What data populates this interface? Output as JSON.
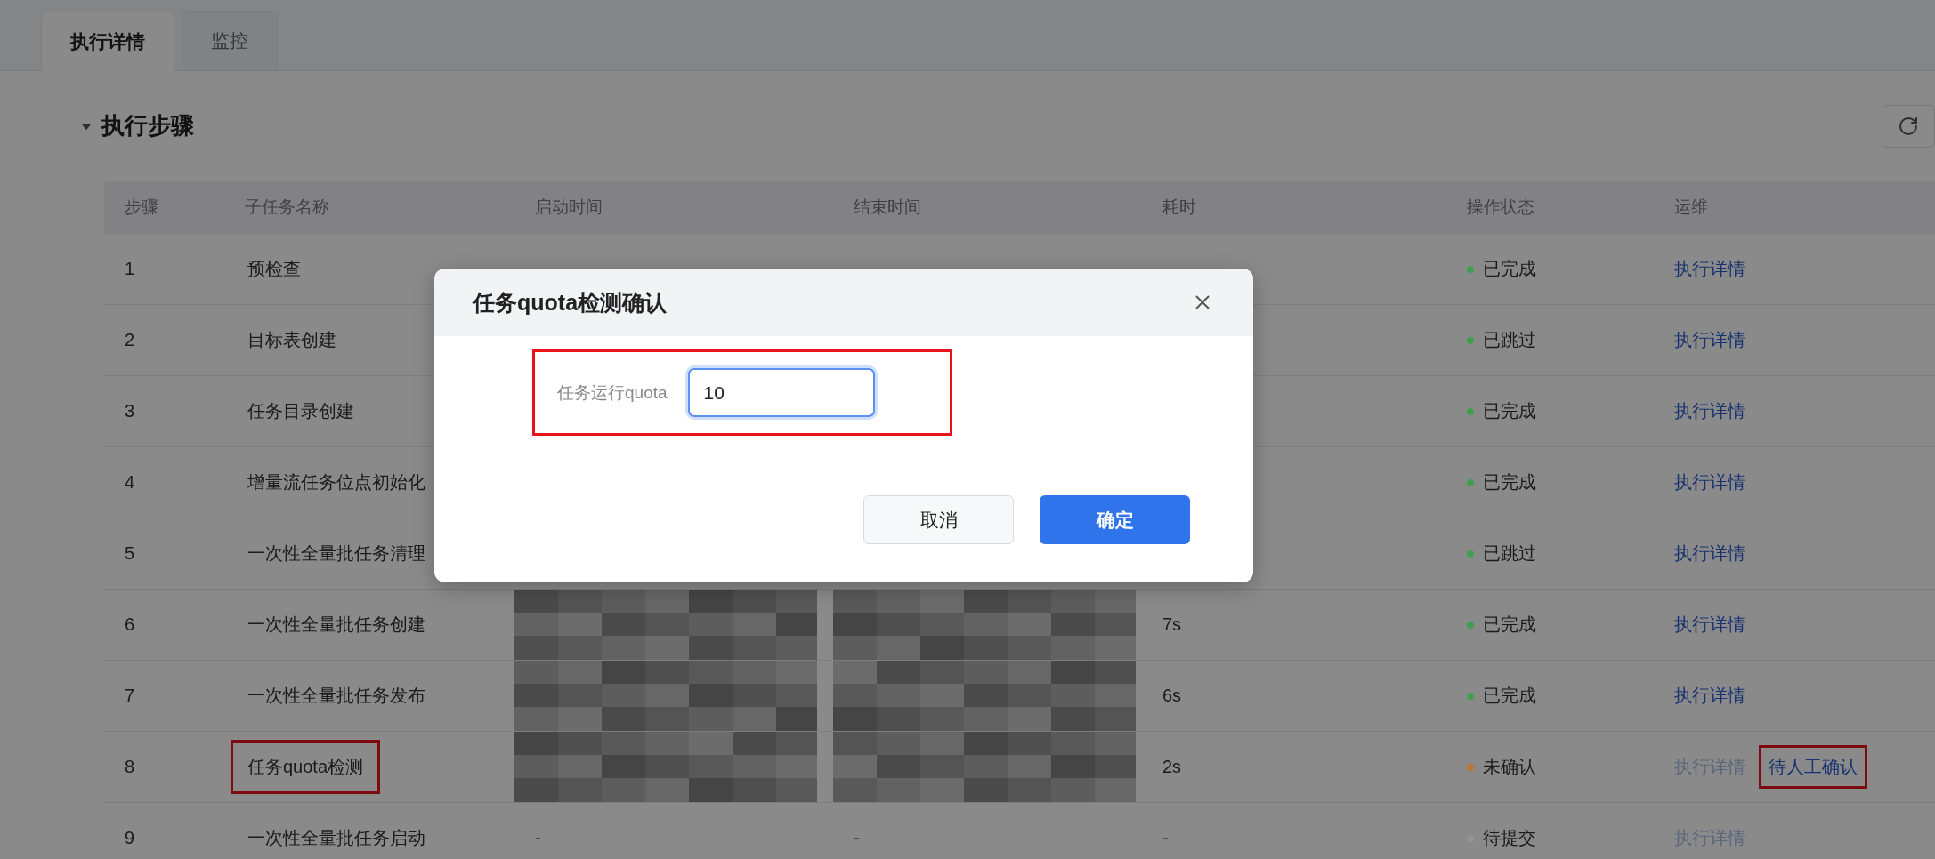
{
  "tabs": [
    {
      "label": "执行详情",
      "selected": true
    },
    {
      "label": "监控",
      "selected": false
    }
  ],
  "section": {
    "title": "执行步骤",
    "expanded": true
  },
  "table": {
    "columns": [
      "步骤",
      "子任务名称",
      "启动时间",
      "结束时间",
      "耗时",
      "操作状态",
      "运维"
    ],
    "rows": [
      {
        "step": "1",
        "name": "预检查",
        "name_highlighted": false,
        "redacted": false,
        "status": "已完成",
        "color": "#3f9f4f",
        "actions": [
          {
            "label": "执行详情",
            "disabled": false,
            "highlighted": false
          }
        ]
      },
      {
        "step": "2",
        "name": "目标表创建",
        "name_highlighted": false,
        "status": "已跳过",
        "color": "#3f9f4f",
        "actions": [
          {
            "label": "执行详情",
            "disabled": false,
            "highlighted": false
          }
        ]
      },
      {
        "step": "3",
        "name": "任务目录创建",
        "name_highlighted": false,
        "status": "已完成",
        "color": "#3f9f4f",
        "actions": [
          {
            "label": "执行详情",
            "disabled": false,
            "highlighted": false
          }
        ]
      },
      {
        "step": "4",
        "name": "增量流任务位点初始化",
        "name_highlighted": false,
        "status": "已完成",
        "color": "#3f9f4f",
        "actions": [
          {
            "label": "执行详情",
            "disabled": false,
            "highlighted": false
          }
        ]
      },
      {
        "step": "5",
        "name": "一次性全量批任务清理",
        "name_highlighted": false,
        "redacted": false,
        "status": "已跳过",
        "color": "#3f9f4f",
        "actions": [
          {
            "label": "执行详情",
            "disabled": false,
            "highlighted": false
          }
        ]
      },
      {
        "step": "6",
        "name": "一次性全量批任务创建",
        "name_highlighted": false,
        "redacted": true,
        "duration": "7s",
        "status": "已完成",
        "color": "#3f9f4f",
        "actions": [
          {
            "label": "执行详情",
            "disabled": false,
            "highlighted": false
          }
        ]
      },
      {
        "step": "7",
        "name": "一次性全量批任务发布",
        "name_highlighted": false,
        "redacted": true,
        "duration": "6s",
        "status": "已完成",
        "color": "#3f9f4f",
        "actions": [
          {
            "label": "执行详情",
            "disabled": false,
            "highlighted": false
          }
        ]
      },
      {
        "step": "8",
        "name": "任务quota检测",
        "name_highlighted": true,
        "redacted": true,
        "duration": "2s",
        "status": "未确认",
        "color": "#b87630",
        "actions": [
          {
            "label": "执行详情",
            "disabled": true,
            "highlighted": false
          },
          {
            "label": "待人工确认",
            "disabled": false,
            "highlighted": true
          }
        ]
      },
      {
        "step": "9",
        "name": "一次性全量批任务启动",
        "name_highlighted": false,
        "start": "-",
        "end": "-",
        "duration": "-",
        "redacted": false,
        "status": "待提交",
        "color": "#959595",
        "actions": [
          {
            "label": "执行详情",
            "disabled": true,
            "highlighted": false
          }
        ]
      }
    ]
  },
  "dialog": {
    "title": "任务quota检测确认",
    "field": {
      "label": "任务运行quota",
      "value": "10",
      "focused": true,
      "highlighted": true
    },
    "buttons": [
      {
        "label": "取消",
        "kind": "secondary"
      },
      {
        "label": "确定",
        "kind": "primary"
      }
    ]
  }
}
